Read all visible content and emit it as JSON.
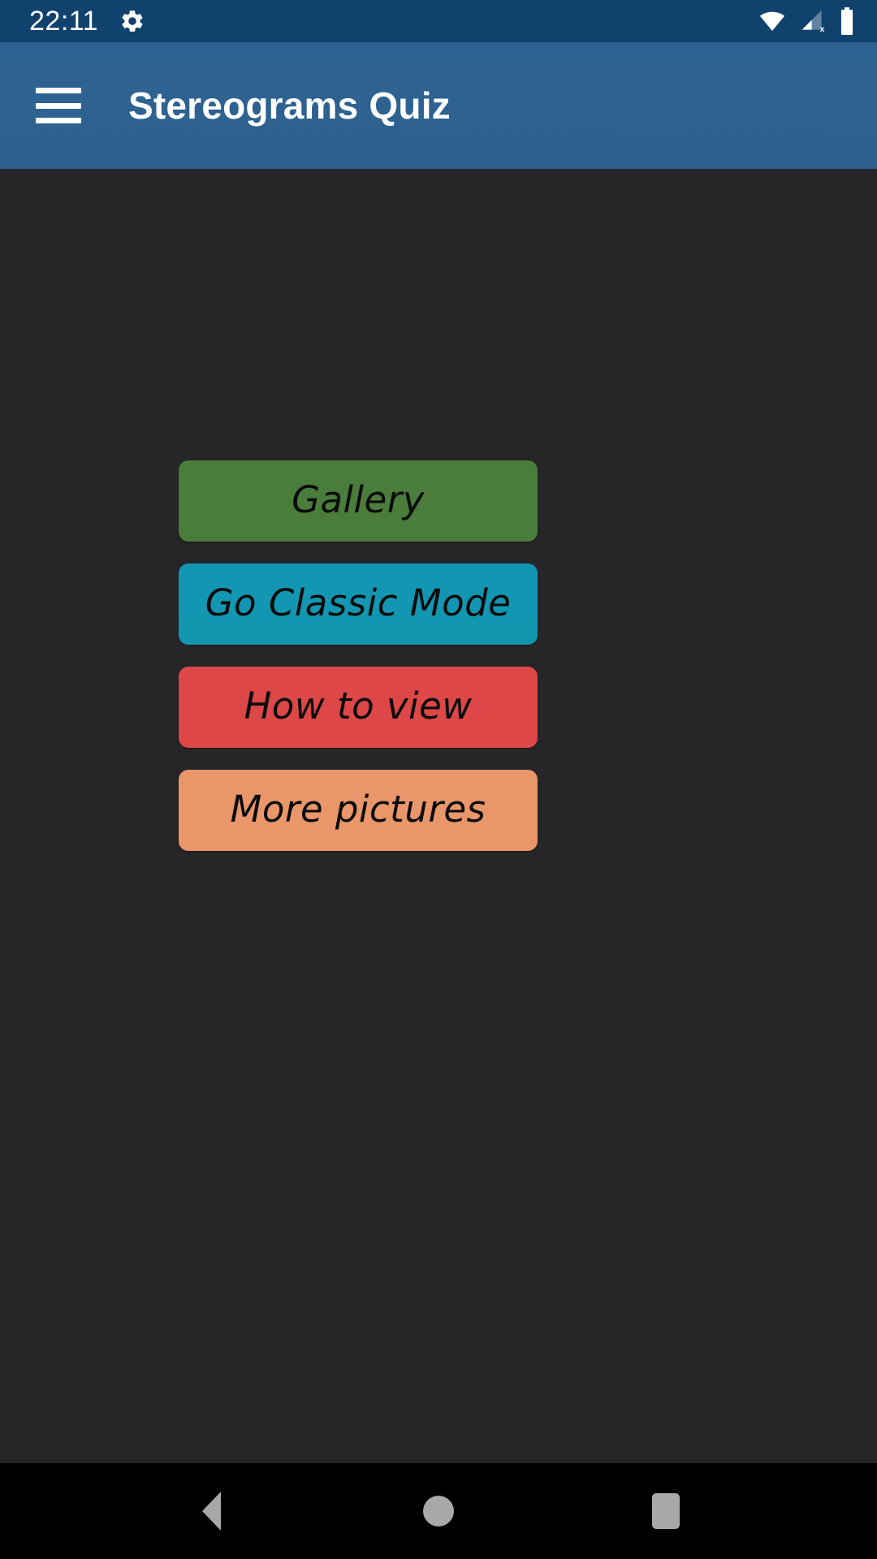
{
  "status_bar": {
    "clock": "22:11",
    "icons": [
      {
        "name": "gear-icon",
        "label": "settings"
      },
      {
        "name": "wifi-icon",
        "label": "wifi-full"
      },
      {
        "name": "cellular-no-sim-icon",
        "label": "cellular-signal-off"
      },
      {
        "name": "battery-icon",
        "label": "battery-full"
      }
    ],
    "colors": {
      "background": "#11416d",
      "foreground": "#ffffff"
    }
  },
  "app_bar": {
    "title": "Stereograms Quiz",
    "menu_icon": "hamburger-menu-icon",
    "colors": {
      "background": "#2e6291",
      "title": "#ffffff"
    }
  },
  "main": {
    "background_color": "#262628",
    "buttons": [
      {
        "label": "Gallery",
        "color": "#4a7c3c",
        "text_color": "#0b0b0b"
      },
      {
        "label": "Go Classic Mode",
        "color": "#1296b2",
        "text_color": "#0b0b0b"
      },
      {
        "label": "How to view",
        "color": "#dd4747",
        "text_color": "#0b0b0b"
      },
      {
        "label": "More pictures",
        "color": "#e9966b",
        "text_color": "#0b0b0b"
      }
    ]
  },
  "nav_bar": {
    "background_color": "#000000",
    "icon_color": "#a8a8a8",
    "buttons": [
      {
        "name": "back-button",
        "icon": "triangle-left-icon"
      },
      {
        "name": "home-button",
        "icon": "circle-icon"
      },
      {
        "name": "recents-button",
        "icon": "square-icon"
      }
    ]
  }
}
